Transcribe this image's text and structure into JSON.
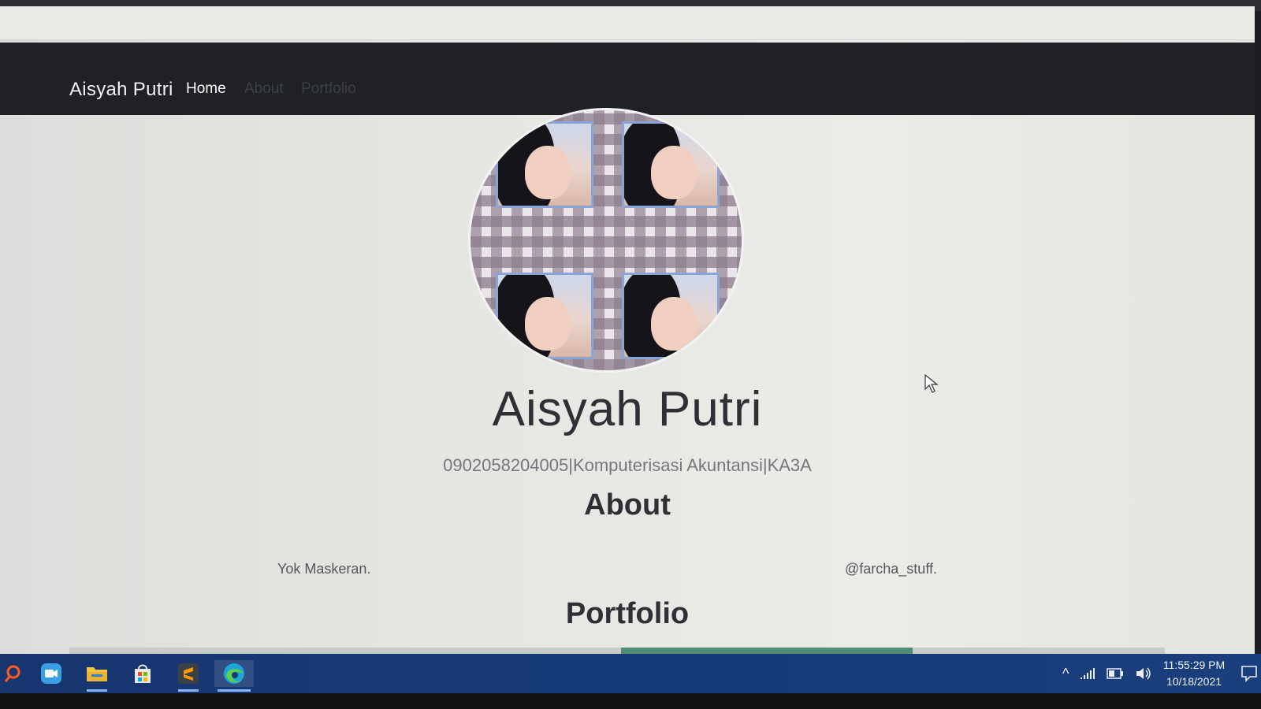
{
  "navbar": {
    "brand": "Aisyah Putri",
    "links": [
      {
        "label": "Home"
      },
      {
        "label": "About"
      },
      {
        "label": "Portfolio"
      }
    ]
  },
  "hero": {
    "name": "Aisyah Putri",
    "subtitle": "0902058204005|Komputerisasi Akuntansi|KA3A"
  },
  "about": {
    "title": "About",
    "left_text": "Yok Maskeran.",
    "right_text": "@farcha_stuff."
  },
  "portfolio": {
    "title": "Portfolio"
  },
  "taskbar": {
    "apps": [
      {
        "icon": "search-icon"
      },
      {
        "icon": "zoom-icon"
      },
      {
        "icon": "file-explorer-icon"
      },
      {
        "icon": "store-icon"
      },
      {
        "icon": "sublime-text-icon"
      },
      {
        "icon": "edge-browser-icon"
      }
    ],
    "time": "11:55:29 PM",
    "date": "10/18/2021"
  },
  "colors": {
    "navbar_bg": "#1f2125",
    "taskbar_bg": "#163a78",
    "page_bg": "#e6e7e2"
  }
}
